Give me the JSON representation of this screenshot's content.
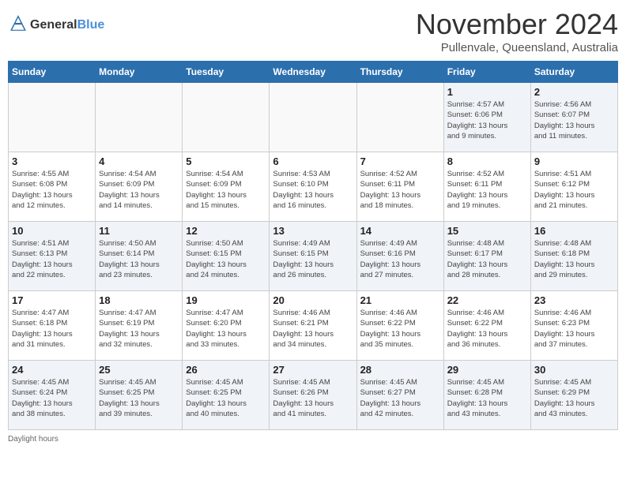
{
  "header": {
    "logo_line1": "General",
    "logo_line2": "Blue",
    "month_title": "November 2024",
    "location": "Pullenvale, Queensland, Australia"
  },
  "footer": {
    "daylight_label": "Daylight hours"
  },
  "weekdays": [
    "Sunday",
    "Monday",
    "Tuesday",
    "Wednesday",
    "Thursday",
    "Friday",
    "Saturday"
  ],
  "weeks": [
    [
      {
        "day": "",
        "info": ""
      },
      {
        "day": "",
        "info": ""
      },
      {
        "day": "",
        "info": ""
      },
      {
        "day": "",
        "info": ""
      },
      {
        "day": "",
        "info": ""
      },
      {
        "day": "1",
        "info": "Sunrise: 4:57 AM\nSunset: 6:06 PM\nDaylight: 13 hours\nand 9 minutes."
      },
      {
        "day": "2",
        "info": "Sunrise: 4:56 AM\nSunset: 6:07 PM\nDaylight: 13 hours\nand 11 minutes."
      }
    ],
    [
      {
        "day": "3",
        "info": "Sunrise: 4:55 AM\nSunset: 6:08 PM\nDaylight: 13 hours\nand 12 minutes."
      },
      {
        "day": "4",
        "info": "Sunrise: 4:54 AM\nSunset: 6:09 PM\nDaylight: 13 hours\nand 14 minutes."
      },
      {
        "day": "5",
        "info": "Sunrise: 4:54 AM\nSunset: 6:09 PM\nDaylight: 13 hours\nand 15 minutes."
      },
      {
        "day": "6",
        "info": "Sunrise: 4:53 AM\nSunset: 6:10 PM\nDaylight: 13 hours\nand 16 minutes."
      },
      {
        "day": "7",
        "info": "Sunrise: 4:52 AM\nSunset: 6:11 PM\nDaylight: 13 hours\nand 18 minutes."
      },
      {
        "day": "8",
        "info": "Sunrise: 4:52 AM\nSunset: 6:11 PM\nDaylight: 13 hours\nand 19 minutes."
      },
      {
        "day": "9",
        "info": "Sunrise: 4:51 AM\nSunset: 6:12 PM\nDaylight: 13 hours\nand 21 minutes."
      }
    ],
    [
      {
        "day": "10",
        "info": "Sunrise: 4:51 AM\nSunset: 6:13 PM\nDaylight: 13 hours\nand 22 minutes."
      },
      {
        "day": "11",
        "info": "Sunrise: 4:50 AM\nSunset: 6:14 PM\nDaylight: 13 hours\nand 23 minutes."
      },
      {
        "day": "12",
        "info": "Sunrise: 4:50 AM\nSunset: 6:15 PM\nDaylight: 13 hours\nand 24 minutes."
      },
      {
        "day": "13",
        "info": "Sunrise: 4:49 AM\nSunset: 6:15 PM\nDaylight: 13 hours\nand 26 minutes."
      },
      {
        "day": "14",
        "info": "Sunrise: 4:49 AM\nSunset: 6:16 PM\nDaylight: 13 hours\nand 27 minutes."
      },
      {
        "day": "15",
        "info": "Sunrise: 4:48 AM\nSunset: 6:17 PM\nDaylight: 13 hours\nand 28 minutes."
      },
      {
        "day": "16",
        "info": "Sunrise: 4:48 AM\nSunset: 6:18 PM\nDaylight: 13 hours\nand 29 minutes."
      }
    ],
    [
      {
        "day": "17",
        "info": "Sunrise: 4:47 AM\nSunset: 6:18 PM\nDaylight: 13 hours\nand 31 minutes."
      },
      {
        "day": "18",
        "info": "Sunrise: 4:47 AM\nSunset: 6:19 PM\nDaylight: 13 hours\nand 32 minutes."
      },
      {
        "day": "19",
        "info": "Sunrise: 4:47 AM\nSunset: 6:20 PM\nDaylight: 13 hours\nand 33 minutes."
      },
      {
        "day": "20",
        "info": "Sunrise: 4:46 AM\nSunset: 6:21 PM\nDaylight: 13 hours\nand 34 minutes."
      },
      {
        "day": "21",
        "info": "Sunrise: 4:46 AM\nSunset: 6:22 PM\nDaylight: 13 hours\nand 35 minutes."
      },
      {
        "day": "22",
        "info": "Sunrise: 4:46 AM\nSunset: 6:22 PM\nDaylight: 13 hours\nand 36 minutes."
      },
      {
        "day": "23",
        "info": "Sunrise: 4:46 AM\nSunset: 6:23 PM\nDaylight: 13 hours\nand 37 minutes."
      }
    ],
    [
      {
        "day": "24",
        "info": "Sunrise: 4:45 AM\nSunset: 6:24 PM\nDaylight: 13 hours\nand 38 minutes."
      },
      {
        "day": "25",
        "info": "Sunrise: 4:45 AM\nSunset: 6:25 PM\nDaylight: 13 hours\nand 39 minutes."
      },
      {
        "day": "26",
        "info": "Sunrise: 4:45 AM\nSunset: 6:25 PM\nDaylight: 13 hours\nand 40 minutes."
      },
      {
        "day": "27",
        "info": "Sunrise: 4:45 AM\nSunset: 6:26 PM\nDaylight: 13 hours\nand 41 minutes."
      },
      {
        "day": "28",
        "info": "Sunrise: 4:45 AM\nSunset: 6:27 PM\nDaylight: 13 hours\nand 42 minutes."
      },
      {
        "day": "29",
        "info": "Sunrise: 4:45 AM\nSunset: 6:28 PM\nDaylight: 13 hours\nand 43 minutes."
      },
      {
        "day": "30",
        "info": "Sunrise: 4:45 AM\nSunset: 6:29 PM\nDaylight: 13 hours\nand 43 minutes."
      }
    ]
  ]
}
